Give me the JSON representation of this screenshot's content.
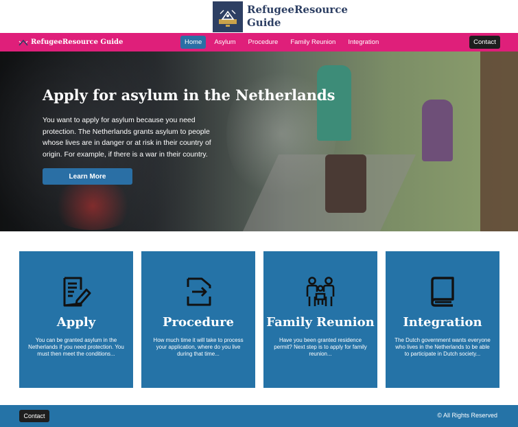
{
  "logo": {
    "title": "RefugeeResource Guide",
    "icon": "logo-emblem"
  },
  "nav": {
    "brand": "RefugeeResource Guide",
    "links": [
      "Home",
      "Asylum",
      "Procedure",
      "Family Reunion",
      "Integration"
    ],
    "active": "Home",
    "contact": "Contact",
    "colors": {
      "bar": "#df1f7a",
      "active": "#2a6fa5"
    }
  },
  "hero": {
    "title": "Apply for asylum in the Netherlands",
    "text": "You want to apply for asylum because you need protection. The Netherlands grants asylum to people whose lives are in danger or at risk in their country of origin. For example, if there is a war in their country.",
    "button": "Learn More"
  },
  "cards": [
    {
      "icon": "document-pen-icon",
      "title": "Apply",
      "text": "You can be granted asylum in the Netherlands if you need protection. You must then meet the conditions..."
    },
    {
      "icon": "procedure-arrow-icon",
      "title": "Procedure",
      "text": "How much time it will take to process your application, where do you live during that time..."
    },
    {
      "icon": "family-icon",
      "title": "Family Reunion",
      "text": "Have you been granted residence permit? Next step is to apply for family reunion..."
    },
    {
      "icon": "book-icon",
      "title": "Integration",
      "text": "The Dutch government wants everyone who lives in the Netherlands to be able to participate in Dutch society..."
    }
  ],
  "footer": {
    "contact": "Contact",
    "copyright": "© All Rights Reserved"
  },
  "colors": {
    "card": "#2573a7",
    "footer": "#2573a7",
    "logo_box": "#2d3f63"
  }
}
